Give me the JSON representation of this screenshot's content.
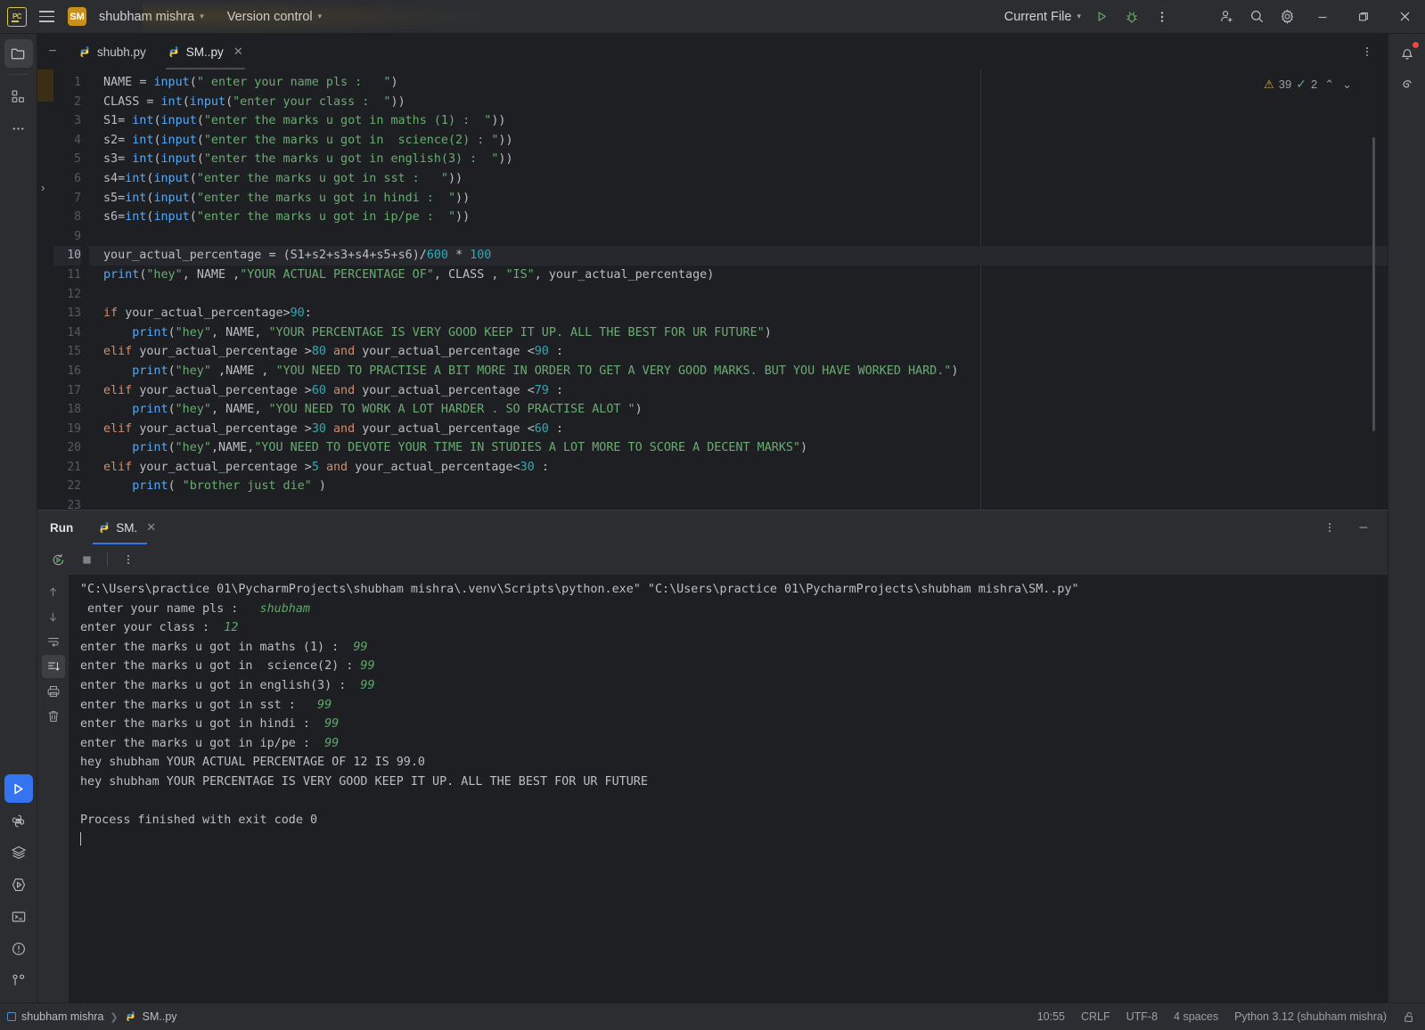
{
  "titlebar": {
    "app_logo": "pycharm-logo",
    "project_badge": "SM",
    "project_name": "shubham mishra",
    "version_control": "Version control",
    "run_config": "Current File",
    "icons": [
      "run-icon",
      "debug-icon",
      "more-options-icon",
      "add-user-icon",
      "search-icon",
      "settings-icon",
      "minimize-icon",
      "maximize-icon",
      "close-icon"
    ]
  },
  "tabs": {
    "items": [
      {
        "label": "shubh.py",
        "active": false
      },
      {
        "label": "SM..py",
        "active": true
      }
    ]
  },
  "editor": {
    "inspection": {
      "warning_count": "39",
      "check_count": "2"
    },
    "current_line": 10,
    "lines": [
      {
        "n": 1,
        "text": "NAME = input(\" enter your name pls :   \")"
      },
      {
        "n": 2,
        "text": "CLASS = int(input(\"enter your class :  \"))"
      },
      {
        "n": 3,
        "text": "S1= int(input(\"enter the marks u got in maths (1) :  \"))"
      },
      {
        "n": 4,
        "text": "s2= int(input(\"enter the marks u got in  science(2) : \"))"
      },
      {
        "n": 5,
        "text": "s3= int(input(\"enter the marks u got in english(3) :  \"))"
      },
      {
        "n": 6,
        "text": "s4=int(input(\"enter the marks u got in sst :   \"))"
      },
      {
        "n": 7,
        "text": "s5=int(input(\"enter the marks u got in hindi :  \"))"
      },
      {
        "n": 8,
        "text": "s6=int(input(\"enter the marks u got in ip/pe :  \"))"
      },
      {
        "n": 9,
        "text": ""
      },
      {
        "n": 10,
        "text": "your_actual_percentage = (S1+s2+s3+s4+s5+s6)/600 * 100"
      },
      {
        "n": 11,
        "text": "print(\"hey\", NAME ,\"YOUR ACTUAL PERCENTAGE OF\", CLASS , \"IS\", your_actual_percentage)"
      },
      {
        "n": 12,
        "text": ""
      },
      {
        "n": 13,
        "text": "if your_actual_percentage>90:"
      },
      {
        "n": 14,
        "text": "    print(\"hey\", NAME, \"YOUR PERCENTAGE IS VERY GOOD KEEP IT UP. ALL THE BEST FOR UR FUTURE\")"
      },
      {
        "n": 15,
        "text": "elif your_actual_percentage >80 and your_actual_percentage <90 :"
      },
      {
        "n": 16,
        "text": "    print(\"hey\" ,NAME , \"YOU NEED TO PRACTISE A BIT MORE IN ORDER TO GET A VERY GOOD MARKS. BUT YOU HAVE WORKED HARD.\")"
      },
      {
        "n": 17,
        "text": "elif your_actual_percentage >60 and your_actual_percentage <79 :"
      },
      {
        "n": 18,
        "text": "    print(\"hey\", NAME, \"YOU NEED TO WORK A LOT HARDER . SO PRACTISE ALOT \")"
      },
      {
        "n": 19,
        "text": "elif your_actual_percentage >30 and your_actual_percentage <60 :"
      },
      {
        "n": 20,
        "text": "    print(\"hey\",NAME,\"YOU NEED TO DEVOTE YOUR TIME IN STUDIES A LOT MORE TO SCORE A DECENT MARKS\")"
      },
      {
        "n": 21,
        "text": "elif your_actual_percentage >5 and your_actual_percentage<30 :"
      },
      {
        "n": 22,
        "text": "    print( \"brother just die\" )"
      },
      {
        "n": 23,
        "text": ""
      }
    ]
  },
  "run_panel": {
    "title": "Run",
    "tab_label": "SM.",
    "toolbar_icons": [
      "rerun-icon",
      "stop-icon",
      "more-icon"
    ],
    "side_icons": [
      "up-arrow-icon",
      "down-arrow-icon",
      "soft-wrap-icon",
      "scroll-to-end-icon",
      "print-icon",
      "trash-icon"
    ],
    "console_lines": [
      {
        "text": "\"C:\\Users\\practice 01\\PycharmProjects\\shubham mishra\\.venv\\Scripts\\python.exe\" \"C:\\Users\\practice 01\\PycharmProjects\\shubham mishra\\SM..py\"",
        "input": ""
      },
      {
        "text": " enter your name pls :   ",
        "input": "shubham"
      },
      {
        "text": "enter your class :  ",
        "input": "12"
      },
      {
        "text": "enter the marks u got in maths (1) :  ",
        "input": "99"
      },
      {
        "text": "enter the marks u got in  science(2) : ",
        "input": "99"
      },
      {
        "text": "enter the marks u got in english(3) :  ",
        "input": "99"
      },
      {
        "text": "enter the marks u got in sst :   ",
        "input": "99"
      },
      {
        "text": "enter the marks u got in hindi :  ",
        "input": "99"
      },
      {
        "text": "enter the marks u got in ip/pe :  ",
        "input": "99"
      },
      {
        "text": "hey shubham YOUR ACTUAL PERCENTAGE OF 12 IS 99.0",
        "input": ""
      },
      {
        "text": "hey shubham YOUR PERCENTAGE IS VERY GOOD KEEP IT UP. ALL THE BEST FOR UR FUTURE",
        "input": ""
      },
      {
        "text": "",
        "input": ""
      },
      {
        "text": "Process finished with exit code 0",
        "input": ""
      }
    ]
  },
  "statusbar": {
    "project": "shubham mishra",
    "file": "SM..py",
    "time": "10:55",
    "line_ending": "CRLF",
    "encoding": "UTF-8",
    "indent": "4 spaces",
    "interpreter": "Python 3.12 (shubham mishra)",
    "lock_icon": "unlocked-icon"
  },
  "rail": {
    "top_icons": [
      "project-folder-icon",
      "structure-icon",
      "more-tool-windows-icon"
    ],
    "bottom_icons": [
      "run-tool-icon",
      "python-packages-icon",
      "services-icon",
      "run-anything-icon",
      "terminal-icon",
      "problems-icon",
      "version-control-icon"
    ]
  },
  "right_rail": {
    "icons": [
      "notifications-icon",
      "ai-assistant-icon"
    ]
  },
  "colors": {
    "accent_blue": "#3574f0",
    "bg_dark": "#1e1f22",
    "bg_panel": "#2b2d30",
    "string_green": "#6aab73",
    "keyword_orange": "#cf8e6d",
    "number_cyan": "#2aacb8",
    "warning_yellow": "#d9a33a"
  }
}
